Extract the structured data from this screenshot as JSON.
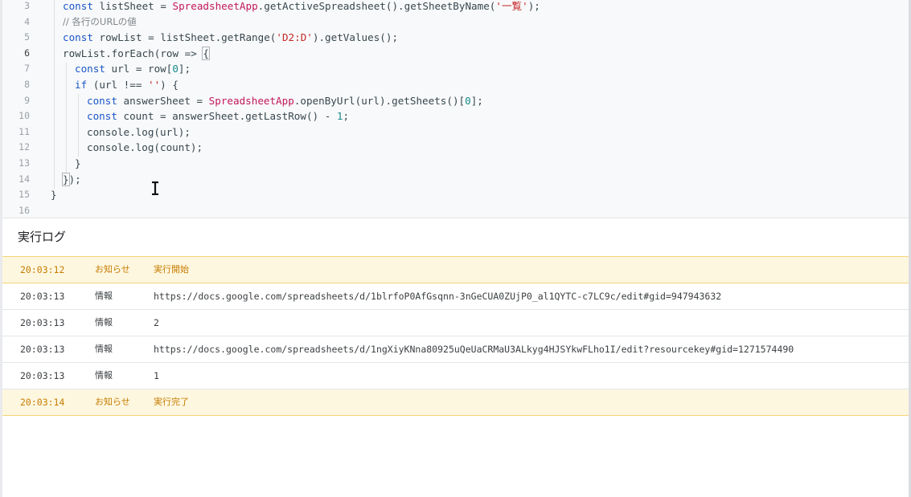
{
  "editor": {
    "lines": [
      {
        "num": "3",
        "text": "const listSheet = SpreadsheetApp.getActiveSpreadsheet().getSheetByName('一覧');"
      },
      {
        "num": "4",
        "text": "// 各行のURLの値"
      },
      {
        "num": "5",
        "text": "const rowList = listSheet.getRange('D2:D').getValues();"
      },
      {
        "num": "6",
        "text": "rowList.forEach(row => {"
      },
      {
        "num": "7",
        "text": "const url = row[0];"
      },
      {
        "num": "8",
        "text": "if (url !== '') {"
      },
      {
        "num": "9",
        "text": "const answerSheet = SpreadsheetApp.openByUrl(url).getSheets()[0];"
      },
      {
        "num": "10",
        "text": "const count = answerSheet.getLastRow() - 1;"
      },
      {
        "num": "11",
        "text": "console.log(url);"
      },
      {
        "num": "12",
        "text": "console.log(count);"
      },
      {
        "num": "13",
        "text": "}"
      },
      {
        "num": "14",
        "text": "});"
      },
      {
        "num": "15",
        "text": "}"
      },
      {
        "num": "16",
        "text": ""
      }
    ],
    "tokens": {
      "const": "const",
      "if": "if",
      "listSheet_decl": " listSheet = ",
      "spreadsheetapp": "SpreadsheetApp",
      "getactive": ".getActiveSpreadsheet().getSheetByName(",
      "sheetname": "'一覧'",
      "close_semicolon": ");",
      "comment": "// 各行のURLの値",
      "rowlist_decl": " rowList = listSheet.getRange(",
      "range": "'D2:D'",
      "getvalues": ").getValues();",
      "foreach": "rowList.forEach(row => ",
      "open_brace": "{",
      "url_decl": " url = row[",
      "zero": "0",
      "idx_close": "];",
      "if_cond": " (url !== ",
      "empty_str": "''",
      "if_close": ") {",
      "answer_decl": " answerSheet = ",
      "openbyurl": ".openByUrl(url).getSheets()[",
      "count_decl": " count = answerSheet.getLastRow() - ",
      "one": "1",
      "semicolon": ";",
      "log_url": "console.log(url);",
      "log_count": "console.log(count);",
      "close_brace": "}",
      "close_brace2": "}",
      "close_paren": ");"
    }
  },
  "log": {
    "title": "実行ログ",
    "rows": [
      {
        "time": "20:03:12",
        "level": "お知らせ",
        "message": "実行開始",
        "type": "notice"
      },
      {
        "time": "20:03:13",
        "level": "情報",
        "message": "https://docs.google.com/spreadsheets/d/1blrfoP0AfGsqnn-3nGeCUA0ZUjP0_al1QYTC-c7LC9c/edit#gid=947943632",
        "type": "info"
      },
      {
        "time": "20:03:13",
        "level": "情報",
        "message": "2",
        "type": "info"
      },
      {
        "time": "20:03:13",
        "level": "情報",
        "message": "https://docs.google.com/spreadsheets/d/1ngXiyKNna80925uQeUaCRMaU3ALkyg4HJSYkwFLho1I/edit?resourcekey#gid=1271574490",
        "type": "info"
      },
      {
        "time": "20:03:13",
        "level": "情報",
        "message": "1",
        "type": "info"
      },
      {
        "time": "20:03:14",
        "level": "お知らせ",
        "message": "実行完了",
        "type": "notice"
      }
    ]
  },
  "colors": {
    "keyword": "#1a56c8",
    "class": "#c2185b",
    "string": "#c62828",
    "number": "#1a8a8a",
    "notice_bg": "#fef7e0",
    "notice_text": "#c67c00"
  }
}
